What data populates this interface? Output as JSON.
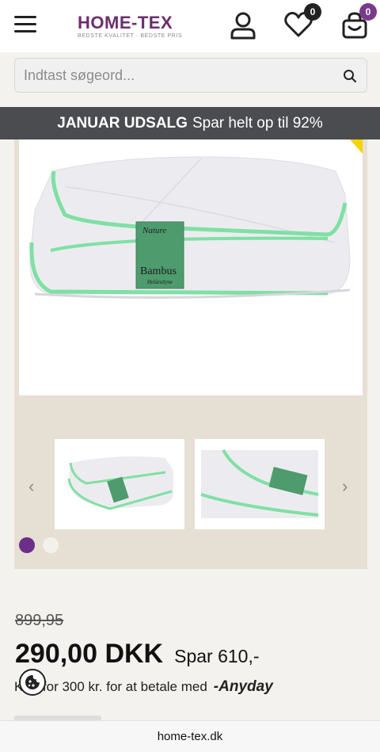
{
  "header": {
    "logo_main": "HOME-TEX",
    "logo_tagline": "BEDSTE KVALITET · BEDSTE PRIS",
    "wishlist_count": "0",
    "cart_count": "0",
    "brand_color": "#6b2f6f",
    "accent_color": "#7a3a8c"
  },
  "search": {
    "placeholder": "Indtast søgeord..."
  },
  "promo": {
    "bold": "JANUAR UDSALG",
    "text": "Spar helt op til 92%"
  },
  "gallery": {
    "tag_brand": "Nature",
    "tag_product": "Bambus",
    "tag_sub": "Helårsdyne",
    "prev_icon": "‹",
    "next_icon": "›",
    "swatches": [
      "#6b2f8a",
      "#f3f1ea"
    ]
  },
  "pricing": {
    "old_price": "899,95",
    "price": "290,00 DKK",
    "save": "Spar 610,-",
    "anyday_text": "Køb for 300 kr. for at betale med",
    "anyday_logo": "-Anyday"
  },
  "browser": {
    "url": "home-tex.dk"
  }
}
